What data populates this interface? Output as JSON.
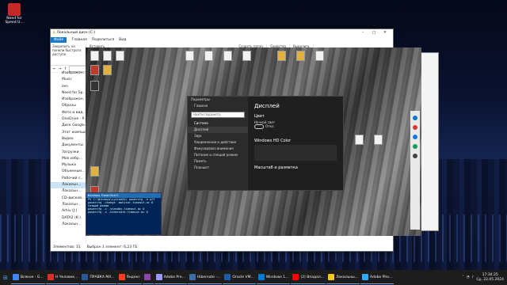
{
  "desktop": {
    "icons": [
      {
        "label": "Need for Speed U...",
        "color": "#d33"
      },
      {
        "label": "",
        "color": "#444"
      }
    ]
  },
  "explorer": {
    "title": "Локальный диск (C:)",
    "ribbon_tabs": [
      "Файл",
      "Главная",
      "Поделиться",
      "Вид"
    ],
    "ribbon": {
      "pin": "Закрепить на панели быстрого доступа",
      "paste": "Вставить",
      "new_folder": "Создать папку",
      "properties": "Свойства",
      "select": "Выделить"
    },
    "nav": [
      "Изображен...",
      "Music",
      "zen",
      "Need for Sp...",
      "Изображен...",
      "Образы",
      "Фото и вид...",
      "OneDrive - P...",
      "Диск Google...",
      "Этот компьюте...",
      "Видео",
      "Документы",
      "Загрузки",
      "Мое избр...",
      "Музыка",
      "Объемные...",
      "Рабочий с...",
      "Локальн...",
      "Локальн...",
      "CD-дисков...",
      "Локальн...",
      "Arhiv (J:)",
      "DATA2 (K:)",
      "Локальн..."
    ],
    "nav_selected": 17,
    "status": {
      "items": "Элементов: 31",
      "selected": "Выбран 1 элемент: 6,23 ГБ"
    }
  },
  "settings": {
    "title": "Параметры",
    "home": "Главная",
    "search_placeholder": "Найти параметр",
    "section": "Система",
    "items": [
      "Дисплей",
      "Звук",
      "Уведомления и действия",
      "Фокусировка внимания",
      "Питание и спящий режим",
      "Память",
      "Планшет"
    ],
    "active": 0,
    "page_title": "Дисплей",
    "color_heading": "Цвет",
    "night_light_label": "Ночной свет",
    "night_light_state": "Откл.",
    "hdr_heading": "Windows HD Color",
    "scale_heading": "Масштаб и разметка"
  },
  "powershell": {
    "title": "Windows PowerShell",
    "lines": [
      "PS C:\\Windows\\system32> powercfg -h off",
      "powercfg -change -monitor-timeout-ac 0",
      "Спящий режим",
      "powercfg -x -standby-timeout-ac 0",
      "powercfg -x -hibernate-timeout-ac 0"
    ]
  },
  "taskbar": {
    "apps": [
      {
        "label": "Всякое - G...",
        "color": "#4285f4"
      },
      {
        "label": "Н Человек...",
        "color": "#d93025"
      },
      {
        "label": "ПРАВКА МА...",
        "color": "#2b579a"
      },
      {
        "label": "Яндекс",
        "color": "#fc3f1d"
      },
      {
        "label": "",
        "color": "#8e44ad"
      },
      {
        "label": "Adobe Pre...",
        "color": "#9999ff"
      },
      {
        "label": "Hibernate -...",
        "color": "#3a6ea5"
      },
      {
        "label": "Oracle VM...",
        "color": "#1e5aa8"
      },
      {
        "label": "Windows 1...",
        "color": "#0078d4"
      },
      {
        "label": "(2) Впадал...",
        "color": "#ff0000"
      },
      {
        "label": "Локальны...",
        "color": "#f3c623"
      },
      {
        "label": "Adobe Pho...",
        "color": "#31a8ff"
      }
    ],
    "time": "17:34:25",
    "date": "Ср, 22.05.2024"
  }
}
